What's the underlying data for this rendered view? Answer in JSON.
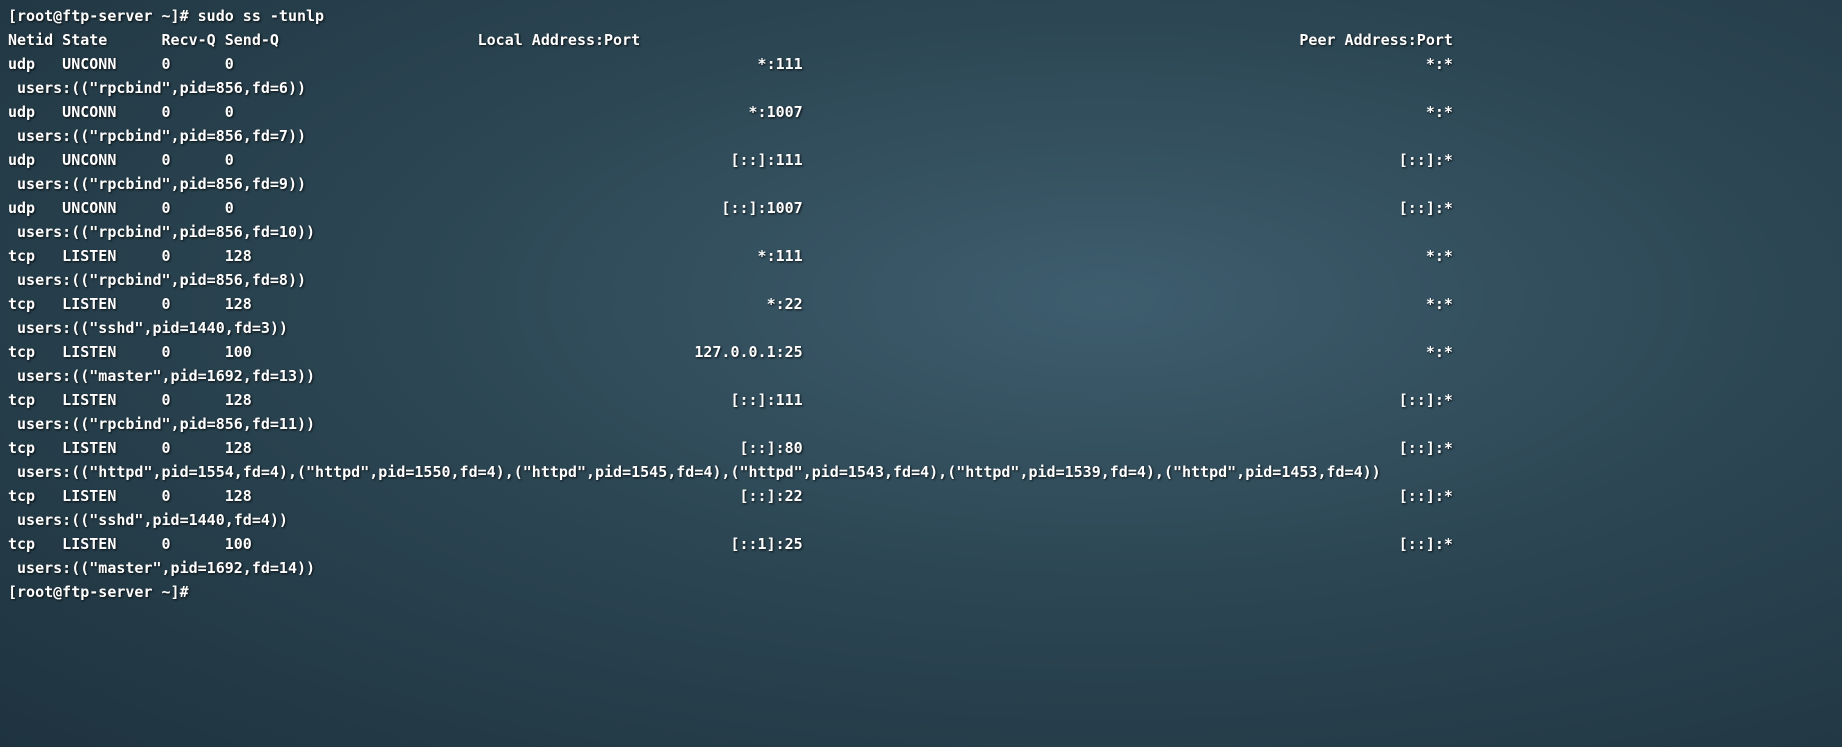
{
  "prompt_user": "root@ftp-server",
  "prompt_dir": "~",
  "prompt_symbol": "#",
  "command": "sudo ss -tunlp",
  "header": {
    "netid": "Netid",
    "state": "State",
    "recvq": "Recv-Q",
    "sendq": "Send-Q",
    "local": "Local Address:Port",
    "peer": "Peer Address:Port"
  },
  "rows": [
    {
      "netid": "udp",
      "state": "UNCONN",
      "recvq": "0",
      "sendq": "0",
      "local": "*:111",
      "peer": "*:*",
      "users": "users:((\"rpcbind\",pid=856,fd=6))"
    },
    {
      "netid": "udp",
      "state": "UNCONN",
      "recvq": "0",
      "sendq": "0",
      "local": "*:1007",
      "peer": "*:*",
      "users": "users:((\"rpcbind\",pid=856,fd=7))"
    },
    {
      "netid": "udp",
      "state": "UNCONN",
      "recvq": "0",
      "sendq": "0",
      "local": "[::]:111",
      "peer": "[::]:*",
      "users": "users:((\"rpcbind\",pid=856,fd=9))"
    },
    {
      "netid": "udp",
      "state": "UNCONN",
      "recvq": "0",
      "sendq": "0",
      "local": "[::]:1007",
      "peer": "[::]:*",
      "users": "users:((\"rpcbind\",pid=856,fd=10))"
    },
    {
      "netid": "tcp",
      "state": "LISTEN",
      "recvq": "0",
      "sendq": "128",
      "local": "*:111",
      "peer": "*:*",
      "users": "users:((\"rpcbind\",pid=856,fd=8))"
    },
    {
      "netid": "tcp",
      "state": "LISTEN",
      "recvq": "0",
      "sendq": "128",
      "local": "*:22",
      "peer": "*:*",
      "users": "users:((\"sshd\",pid=1440,fd=3))"
    },
    {
      "netid": "tcp",
      "state": "LISTEN",
      "recvq": "0",
      "sendq": "100",
      "local": "127.0.0.1:25",
      "peer": "*:*",
      "users": "users:((\"master\",pid=1692,fd=13))"
    },
    {
      "netid": "tcp",
      "state": "LISTEN",
      "recvq": "0",
      "sendq": "128",
      "local": "[::]:111",
      "peer": "[::]:*",
      "users": "users:((\"rpcbind\",pid=856,fd=11))"
    },
    {
      "netid": "tcp",
      "state": "LISTEN",
      "recvq": "0",
      "sendq": "128",
      "local": "[::]:80",
      "peer": "[::]:*",
      "users": "users:((\"httpd\",pid=1554,fd=4),(\"httpd\",pid=1550,fd=4),(\"httpd\",pid=1545,fd=4),(\"httpd\",pid=1543,fd=4),(\"httpd\",pid=1539,fd=4),(\"httpd\",pid=1453,fd=4))"
    },
    {
      "netid": "tcp",
      "state": "LISTEN",
      "recvq": "0",
      "sendq": "128",
      "local": "[::]:22",
      "peer": "[::]:*",
      "users": "users:((\"sshd\",pid=1440,fd=4))"
    },
    {
      "netid": "tcp",
      "state": "LISTEN",
      "recvq": "0",
      "sendq": "100",
      "local": "[::1]:25",
      "peer": "[::]:*",
      "users": "users:((\"master\",pid=1692,fd=14))"
    }
  ],
  "layout": {
    "col_netid_w": 6,
    "col_state_w": 11,
    "col_recvq_w": 7,
    "col_sendq_w": 7,
    "col_local_right_at": 88,
    "col_peer_right_at": 160
  }
}
